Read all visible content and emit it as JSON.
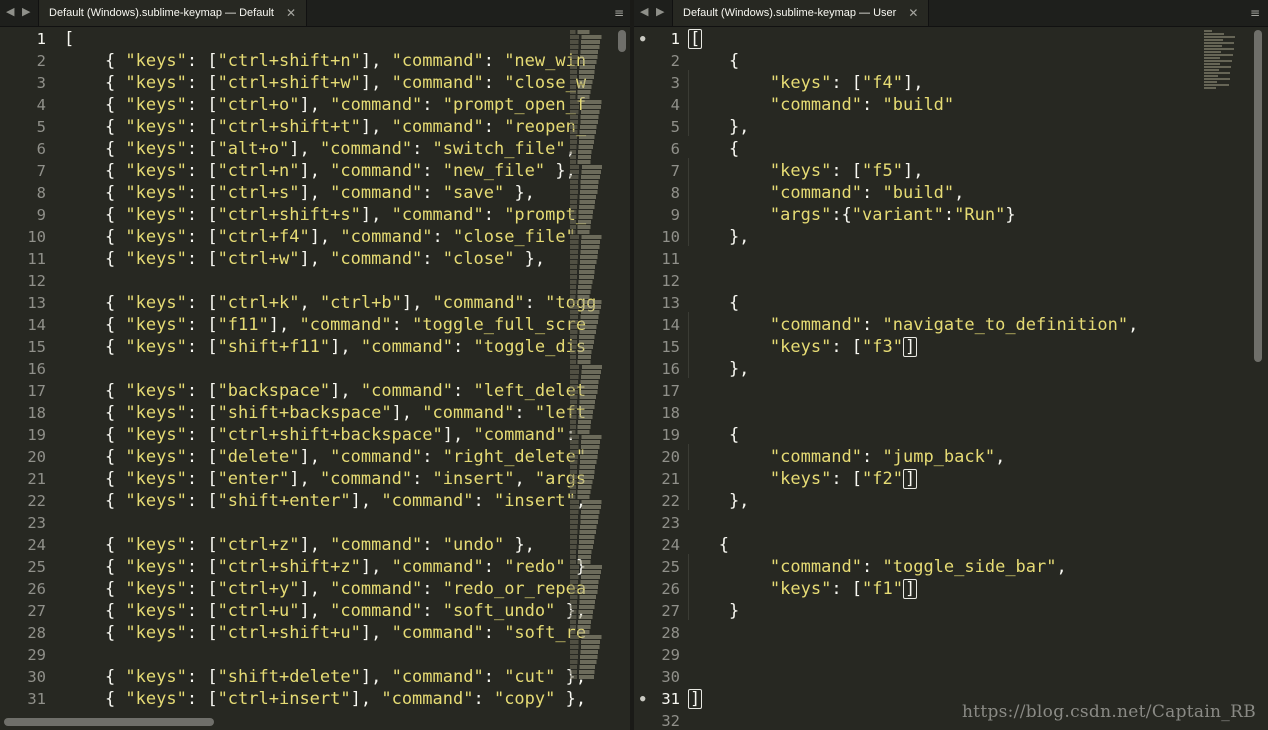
{
  "left": {
    "tab_title": "Default (Windows).sublime-keymap — Default",
    "nav_left": "◀",
    "nav_right": "▶",
    "close_glyph": "✕",
    "menu_glyph": "≡",
    "active_line": "1",
    "lines": [
      {
        "n": "1",
        "t": "["
      },
      {
        "n": "2",
        "t": "    { \"keys\": [\"ctrl+shift+n\"], \"command\": \"new_win"
      },
      {
        "n": "3",
        "t": "    { \"keys\": [\"ctrl+shift+w\"], \"command\": \"close_w"
      },
      {
        "n": "4",
        "t": "    { \"keys\": [\"ctrl+o\"], \"command\": \"prompt_open_f"
      },
      {
        "n": "5",
        "t": "    { \"keys\": [\"ctrl+shift+t\"], \"command\": \"reopen_"
      },
      {
        "n": "6",
        "t": "    { \"keys\": [\"alt+o\"], \"command\": \"switch_file\","
      },
      {
        "n": "7",
        "t": "    { \"keys\": [\"ctrl+n\"], \"command\": \"new_file\" },"
      },
      {
        "n": "8",
        "t": "    { \"keys\": [\"ctrl+s\"], \"command\": \"save\" },"
      },
      {
        "n": "9",
        "t": "    { \"keys\": [\"ctrl+shift+s\"], \"command\": \"prompt_"
      },
      {
        "n": "10",
        "t": "    { \"keys\": [\"ctrl+f4\"], \"command\": \"close_file\""
      },
      {
        "n": "11",
        "t": "    { \"keys\": [\"ctrl+w\"], \"command\": \"close\" },"
      },
      {
        "n": "12",
        "t": ""
      },
      {
        "n": "13",
        "t": "    { \"keys\": [\"ctrl+k\", \"ctrl+b\"], \"command\": \"togg"
      },
      {
        "n": "14",
        "t": "    { \"keys\": [\"f11\"], \"command\": \"toggle_full_scre"
      },
      {
        "n": "15",
        "t": "    { \"keys\": [\"shift+f11\"], \"command\": \"toggle_dis"
      },
      {
        "n": "16",
        "t": ""
      },
      {
        "n": "17",
        "t": "    { \"keys\": [\"backspace\"], \"command\": \"left_delet"
      },
      {
        "n": "18",
        "t": "    { \"keys\": [\"shift+backspace\"], \"command\": \"left"
      },
      {
        "n": "19",
        "t": "    { \"keys\": [\"ctrl+shift+backspace\"], \"command\": "
      },
      {
        "n": "20",
        "t": "    { \"keys\": [\"delete\"], \"command\": \"right_delete\""
      },
      {
        "n": "21",
        "t": "    { \"keys\": [\"enter\"], \"command\": \"insert\", \"args"
      },
      {
        "n": "22",
        "t": "    { \"keys\": [\"shift+enter\"], \"command\": \"insert\","
      },
      {
        "n": "23",
        "t": ""
      },
      {
        "n": "24",
        "t": "    { \"keys\": [\"ctrl+z\"], \"command\": \"undo\" },"
      },
      {
        "n": "25",
        "t": "    { \"keys\": [\"ctrl+shift+z\"], \"command\": \"redo\" }"
      },
      {
        "n": "26",
        "t": "    { \"keys\": [\"ctrl+y\"], \"command\": \"redo_or_repea"
      },
      {
        "n": "27",
        "t": "    { \"keys\": [\"ctrl+u\"], \"command\": \"soft_undo\" },"
      },
      {
        "n": "28",
        "t": "    { \"keys\": [\"ctrl+shift+u\"], \"command\": \"soft_re"
      },
      {
        "n": "29",
        "t": ""
      },
      {
        "n": "30",
        "t": "    { \"keys\": [\"shift+delete\"], \"command\": \"cut\" },"
      },
      {
        "n": "31",
        "t": "    { \"keys\": [\"ctrl+insert\"], \"command\": \"copy\" },"
      }
    ]
  },
  "right": {
    "tab_title": "Default (Windows).sublime-keymap — User",
    "nav_left": "◀",
    "nav_right": "▶",
    "close_glyph": "✕",
    "menu_glyph": "≡",
    "modified_lines": [
      "1",
      "31"
    ],
    "lines": [
      {
        "n": "1",
        "t": "["
      },
      {
        "n": "2",
        "t": "    {"
      },
      {
        "n": "3",
        "t": "        \"keys\": [\"f4\"],"
      },
      {
        "n": "4",
        "t": "        \"command\": \"build\""
      },
      {
        "n": "5",
        "t": "    },"
      },
      {
        "n": "6",
        "t": "    {"
      },
      {
        "n": "7",
        "t": "        \"keys\": [\"f5\"],"
      },
      {
        "n": "8",
        "t": "        \"command\": \"build\","
      },
      {
        "n": "9",
        "t": "        \"args\":{\"variant\":\"Run\"}"
      },
      {
        "n": "10",
        "t": "    },"
      },
      {
        "n": "11",
        "t": ""
      },
      {
        "n": "12",
        "t": ""
      },
      {
        "n": "13",
        "t": "    {"
      },
      {
        "n": "14",
        "t": "        \"command\": \"navigate_to_definition\","
      },
      {
        "n": "15",
        "t": "        \"keys\": [\"f3\"]"
      },
      {
        "n": "16",
        "t": "    },"
      },
      {
        "n": "17",
        "t": ""
      },
      {
        "n": "18",
        "t": ""
      },
      {
        "n": "19",
        "t": "    {"
      },
      {
        "n": "20",
        "t": "        \"command\": \"jump_back\","
      },
      {
        "n": "21",
        "t": "        \"keys\": [\"f2\"]"
      },
      {
        "n": "22",
        "t": "    },"
      },
      {
        "n": "23",
        "t": ""
      },
      {
        "n": "24",
        "t": "   {"
      },
      {
        "n": "25",
        "t": "        \"command\": \"toggle_side_bar\","
      },
      {
        "n": "26",
        "t": "        \"keys\": [\"f1\"]"
      },
      {
        "n": "27",
        "t": "    }"
      },
      {
        "n": "28",
        "t": ""
      },
      {
        "n": "29",
        "t": ""
      },
      {
        "n": "30",
        "t": ""
      },
      {
        "n": "31",
        "t": "]"
      },
      {
        "n": "32",
        "t": ""
      }
    ]
  },
  "watermark": "https://blog.csdn.net/Captain_RB",
  "colors": {
    "background": "#272822",
    "string": "#e6db74",
    "text": "#f8f8f2",
    "line_number": "#90908a"
  }
}
